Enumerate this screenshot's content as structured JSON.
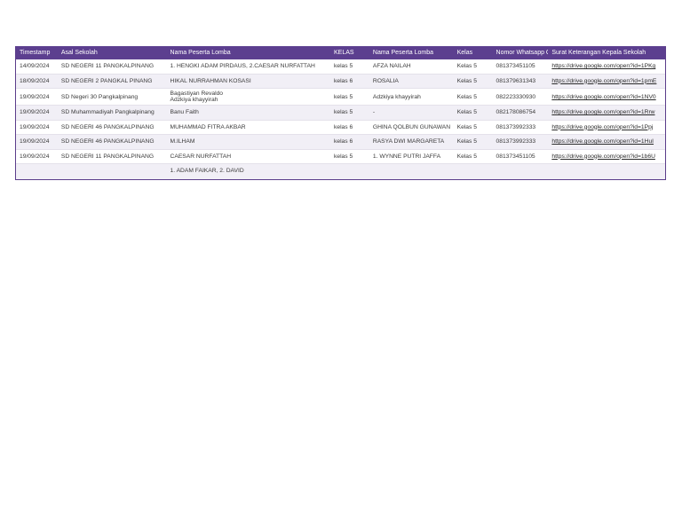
{
  "table": {
    "headers": [
      "Timestamp",
      "Asal Sekolah",
      "Nama Peserta Lomba",
      "KELAS",
      "Nama Peserta Lomba",
      "Kelas",
      "Nomor Whatsapp Orang Tua",
      "Surat Keterangan Kepala Sekolah"
    ],
    "rows": [
      {
        "timestamp": "14/09/2024",
        "sekolah": "SD NEGERI 11 PANGKALPINANG",
        "peserta1": "1. HENGKI ADAM PIRDAUS,  2.CAESAR NURFATTAH",
        "kelas1": "kelas 5",
        "peserta2": "AFZA NAILAH",
        "kelas2": "Kelas 5",
        "whatsapp": "081373451105",
        "surat": "https://drive.google.com/open?id=1PKg"
      },
      {
        "timestamp": "18/09/2024",
        "sekolah": "SD NEGERI 2 PANGKAL PINANG",
        "peserta1": "HIKAL NURRAHMAN KOSASI",
        "kelas1": "kelas 6",
        "peserta2": "ROSALIA",
        "kelas2": "Kelas 5",
        "whatsapp": "081379631343",
        "surat": "https://drive.google.com/open?id=1pmE"
      },
      {
        "timestamp": "19/09/2024",
        "sekolah": "SD Negeri 30 Pangkalpinang",
        "peserta1a": "Bagastiyan Revaldo",
        "peserta1b": "Adzkiya khayyirah",
        "kelas1": "kelas 5",
        "peserta2": "Adzkiya khayyirah",
        "kelas2": "Kelas 5",
        "whatsapp": "082223330930",
        "surat": "https://drive.google.com/open?id=1NV0"
      },
      {
        "timestamp": "19/09/2024",
        "sekolah": "SD Muhammadiyah Pangkalpinang",
        "peserta1": "Banu Faith",
        "kelas1": "kelas 5",
        "peserta2": "-",
        "kelas2": "Kelas 5",
        "whatsapp": "082178086754",
        "surat": "https://drive.google.com/open?id=1Rrw"
      },
      {
        "timestamp": "19/09/2024",
        "sekolah": "SD NEGERI 46 PANGKALPINANG",
        "peserta1": "MUHAMMAD FITRA AKBAR",
        "kelas1": "kelas 6",
        "peserta2": "GHINA QOLBUN GUNAWAN",
        "kelas2": "Kelas 5",
        "whatsapp": "081373992333",
        "surat": "https://drive.google.com/open?id=1Ppj"
      },
      {
        "timestamp": "19/09/2024",
        "sekolah": "SD NEGERI 46 PANGKALPINANG",
        "peserta1": "M.ILHAM",
        "kelas1": "kelas 6",
        "peserta2": "RASYA DWI MARGARETA",
        "kelas2": "Kelas 5",
        "whatsapp": "081373992333",
        "surat": "https://drive.google.com/open?id=1HuI"
      },
      {
        "timestamp": "19/09/2024",
        "sekolah": "SD NEGERI 11 PANGKALPINANG",
        "peserta1": "CAESAR NURFATTAH",
        "kelas1": "kelas 5",
        "peserta2": "1. WYNNE PUTRI JAFFA",
        "kelas2": "Kelas 5",
        "whatsapp": "081373451105",
        "surat": "https://drive.google.com/open?id=1b6U"
      },
      {
        "timestamp": "",
        "sekolah": "",
        "peserta1": "1. ADAM FAIKAR, 2. DAVID",
        "kelas1": "",
        "peserta2": "",
        "kelas2": "",
        "whatsapp": "",
        "surat": ""
      }
    ]
  }
}
